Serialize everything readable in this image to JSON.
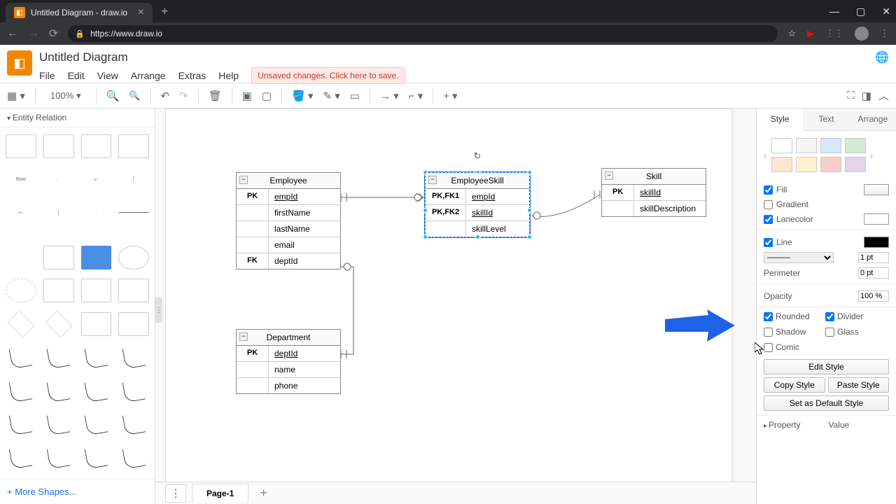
{
  "browser": {
    "tab_title": "Untitled Diagram - draw.io",
    "url": "https://www.draw.io"
  },
  "app": {
    "title": "Untitled Diagram",
    "logo_glyph": "◧"
  },
  "menu": {
    "file": "File",
    "edit": "Edit",
    "view": "View",
    "arrange": "Arrange",
    "extras": "Extras",
    "help": "Help",
    "unsaved": "Unsaved changes. Click here to save."
  },
  "toolbar": {
    "zoom": "100%"
  },
  "sidebar": {
    "header": "Entity Relation",
    "more_shapes": "+ More Shapes..."
  },
  "canvas": {
    "entities": {
      "employee": {
        "title": "Employee",
        "rows": [
          {
            "key": "PK",
            "field": "empId",
            "underline": true
          },
          {
            "key": "",
            "field": "firstName"
          },
          {
            "key": "",
            "field": "lastName"
          },
          {
            "key": "",
            "field": "email"
          },
          {
            "key": "FK",
            "field": "deptId"
          }
        ]
      },
      "employeeskill": {
        "title": "EmployeeSkill",
        "rows": [
          {
            "key": "PK,FK1",
            "field": "empId",
            "underline": true
          },
          {
            "key": "PK,FK2",
            "field": "skillId",
            "underline": true
          },
          {
            "key": "",
            "field": "skillLevel"
          }
        ]
      },
      "skill": {
        "title": "Skill",
        "rows": [
          {
            "key": "PK",
            "field": "skillId",
            "underline": true
          },
          {
            "key": "",
            "field": "skillDescription"
          }
        ]
      },
      "department": {
        "title": "Department",
        "rows": [
          {
            "key": "PK",
            "field": "deptId",
            "underline": true
          },
          {
            "key": "",
            "field": "name"
          },
          {
            "key": "",
            "field": "phone"
          }
        ]
      }
    }
  },
  "right_panel": {
    "tabs": {
      "style": "Style",
      "text": "Text",
      "arrange": "Arrange"
    },
    "swatches": [
      "#ffffff",
      "#f5f5f5",
      "#dae8fc",
      "#d5e8d4",
      "#ffe6cc",
      "#fff2cc",
      "#f8cecc",
      "#e1d5e7"
    ],
    "fill": {
      "label": "Fill",
      "checked": true,
      "color": "#ffffff"
    },
    "gradient": {
      "label": "Gradient",
      "checked": false
    },
    "lanecolor": {
      "label": "Lanecolor",
      "checked": true,
      "color": "#ffffff"
    },
    "line": {
      "label": "Line",
      "checked": true,
      "color": "#000000"
    },
    "line_width": "1 pt",
    "perimeter": {
      "label": "Perimeter",
      "value": "0 pt"
    },
    "opacity": {
      "label": "Opacity",
      "value": "100 %"
    },
    "rounded": {
      "label": "Rounded",
      "checked": true
    },
    "divider": {
      "label": "Divider",
      "checked": true
    },
    "shadow": {
      "label": "Shadow",
      "checked": false
    },
    "glass": {
      "label": "Glass",
      "checked": false
    },
    "comic": {
      "label": "Comic",
      "checked": false
    },
    "edit_style": "Edit Style",
    "copy_style": "Copy Style",
    "paste_style": "Paste Style",
    "default_style": "Set as Default Style",
    "property": "Property",
    "value": "Value"
  },
  "page_bar": {
    "page1": "Page-1"
  }
}
